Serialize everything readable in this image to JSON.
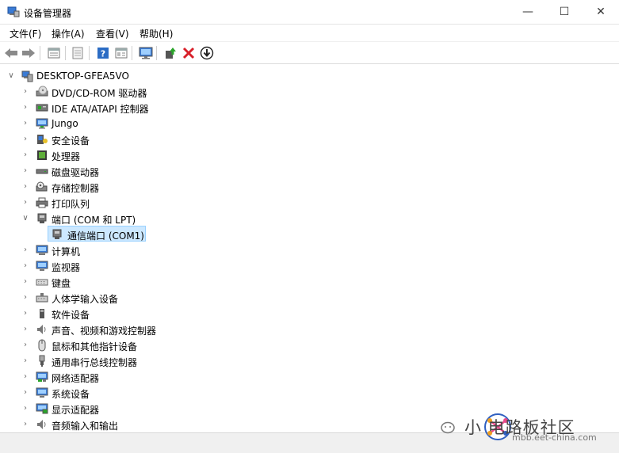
{
  "window": {
    "title": "设备管理器",
    "minimize_glyph": "—",
    "maximize_glyph": "☐",
    "close_glyph": "✕"
  },
  "menu": {
    "items": [
      {
        "label": "文件(F)"
      },
      {
        "label": "操作(A)"
      },
      {
        "label": "查看(V)"
      },
      {
        "label": "帮助(H)"
      }
    ]
  },
  "toolbar": {
    "icons": [
      "back-icon",
      "forward-icon",
      "properties-icon",
      "page-icon",
      "help-icon",
      "details-icon",
      "monitor-icon",
      "update-driver-icon",
      "uninstall-icon",
      "download-icon"
    ]
  },
  "tree": {
    "root": {
      "label": "DESKTOP-GFEA5VO",
      "expander": "∨"
    },
    "collapsed_glyph": "›",
    "expanded_glyph": "∨",
    "items": [
      {
        "label": "DVD/CD-ROM 驱动器",
        "icon": "dvd-drive-icon"
      },
      {
        "label": "IDE ATA/ATAPI 控制器",
        "icon": "ide-controller-icon"
      },
      {
        "label": "Jungo",
        "icon": "jungo-icon"
      },
      {
        "label": "安全设备",
        "icon": "security-device-icon"
      },
      {
        "label": "处理器",
        "icon": "processor-icon"
      },
      {
        "label": "磁盘驱动器",
        "icon": "disk-drive-icon"
      },
      {
        "label": "存储控制器",
        "icon": "storage-controller-icon"
      },
      {
        "label": "打印队列",
        "icon": "printer-icon"
      },
      {
        "label": "端口 (COM 和 LPT)",
        "icon": "port-icon",
        "expanded": true
      },
      {
        "label": "通信端口 (COM1)",
        "icon": "com-port-icon",
        "child": true,
        "selected": true
      },
      {
        "label": "计算机",
        "icon": "computer-icon"
      },
      {
        "label": "监视器",
        "icon": "monitor-icon"
      },
      {
        "label": "键盘",
        "icon": "keyboard-icon"
      },
      {
        "label": "人体学输入设备",
        "icon": "hid-icon"
      },
      {
        "label": "软件设备",
        "icon": "software-device-icon"
      },
      {
        "label": "声音、视频和游戏控制器",
        "icon": "sound-icon"
      },
      {
        "label": "鼠标和其他指针设备",
        "icon": "mouse-icon"
      },
      {
        "label": "通用串行总线控制器",
        "icon": "usb-icon"
      },
      {
        "label": "网络适配器",
        "icon": "network-adapter-icon"
      },
      {
        "label": "系统设备",
        "icon": "system-device-icon"
      },
      {
        "label": "显示适配器",
        "icon": "display-adapter-icon"
      },
      {
        "label": "音频输入和输出",
        "icon": "audio-io-icon"
      }
    ]
  },
  "watermark": {
    "text": "小  电路板社区",
    "sub": "mbb.eet-china.com"
  },
  "colors": {
    "selection": "#cce8ff",
    "selection_border": "#99d1ff",
    "accent_blue": "#2b6cc4",
    "uninstall_red": "#d8202a"
  }
}
